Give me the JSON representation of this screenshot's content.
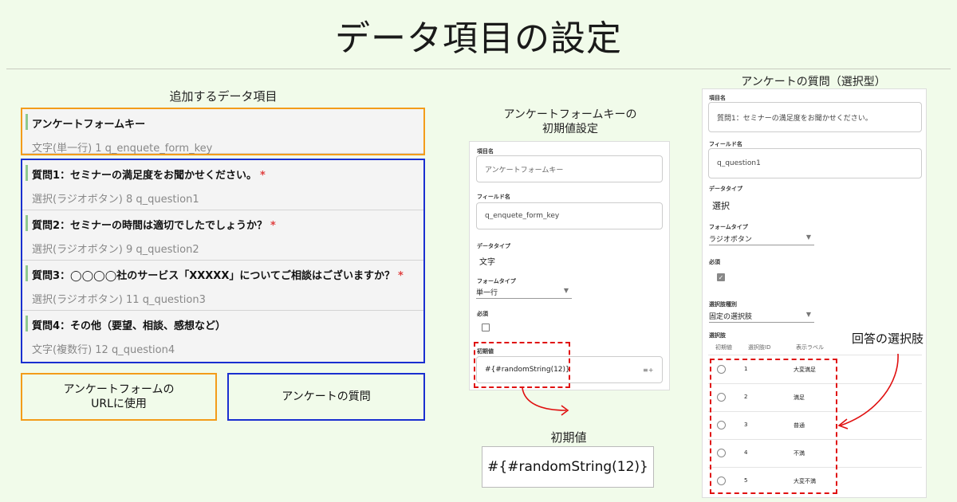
{
  "title": "データ項目の設定",
  "left": {
    "caption": "追加するデータ項目",
    "items": [
      {
        "label": "アンケートフォームキー",
        "sub": "文字(単一行) 1 q_enquete_form_key",
        "required": false
      },
      {
        "label": "質問1：セミナーの満足度をお聞かせください。",
        "sub": "選択(ラジオボタン) 8 q_question1",
        "required": true
      },
      {
        "label": "質問2：セミナーの時間は適切でしたでしょうか？",
        "sub": "選択(ラジオボタン) 9 q_question2",
        "required": true
      },
      {
        "label": "質問3：◯◯◯◯社のサービス「XXXXX」についてご相談はございますか？",
        "sub": "選択(ラジオボタン) 11 q_question3",
        "required": true
      },
      {
        "label": "質問4：その他（要望、相談、感想など）",
        "sub": "文字(複数行) 12 q_question4",
        "required": false
      }
    ],
    "required_mark": "*",
    "legend_orange": "アンケートフォームの\nURLに使用",
    "legend_blue": "アンケートの質問"
  },
  "middle": {
    "caption": "アンケートフォームキーの\n初期値設定",
    "item_name_label": "項目名",
    "item_name_value": "アンケートフォームキー",
    "field_name_label": "フィールド名",
    "field_name_value": "q_enquete_form_key",
    "data_type_label": "データタイプ",
    "data_type_value": "文字",
    "form_type_label": "フォームタイプ",
    "form_type_value": "単一行",
    "required_label": "必須",
    "initial_label": "初期値",
    "initial_value": "#{#randomString(12)}",
    "initial_icon": "≡+",
    "callout_caption": "初期値",
    "callout_value": "#{#randomString(12)}"
  },
  "right": {
    "caption": "アンケートの質問（選択型）",
    "item_name_label": "項目名",
    "item_name_value": "質問1：セミナーの満足度をお聞かせください。",
    "field_name_label": "フィールド名",
    "field_name_value": "q_question1",
    "data_type_label": "データタイプ",
    "data_type_value": "選択",
    "form_type_label": "フォームタイプ",
    "form_type_value": "ラジオボタン",
    "required_label": "必須",
    "required_check": "✓",
    "choice_type_label": "選択肢種別",
    "choice_type_value": "固定の選択肢",
    "choices_label": "選択肢",
    "headers": [
      "初期値",
      "選択肢ID",
      "表示ラベル"
    ],
    "choices": [
      {
        "id": "1",
        "label": "大変満足"
      },
      {
        "id": "2",
        "label": "満足"
      },
      {
        "id": "3",
        "label": "普通"
      },
      {
        "id": "4",
        "label": "不満"
      },
      {
        "id": "5",
        "label": "大変不満"
      }
    ],
    "annotation": "回答の選択肢"
  },
  "colors": {
    "orange": "#f39c1a",
    "blue": "#1a2fd0",
    "red": "#e01010",
    "background": "#f1fbea"
  }
}
